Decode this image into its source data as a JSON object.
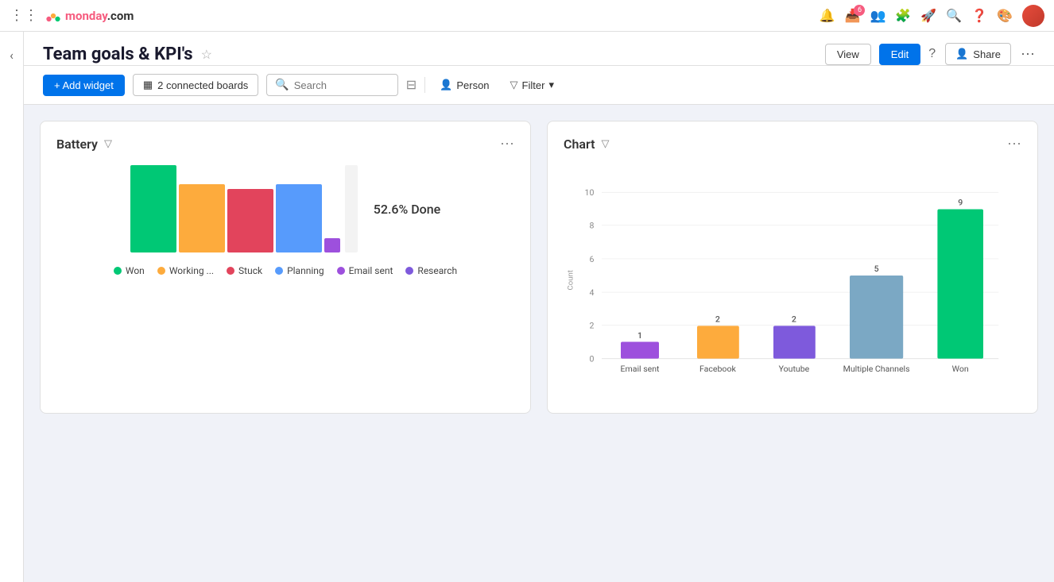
{
  "app": {
    "name": "monday",
    "domain": ".com"
  },
  "topnav": {
    "notifications_badge": "6",
    "help_tooltip": "Help"
  },
  "page": {
    "title": "Team goals & KPI's",
    "view_label": "View",
    "edit_label": "Edit",
    "share_label": "Share",
    "add_widget_label": "+ Add widget",
    "connected_boards_label": "2 connected boards",
    "search_placeholder": "Search",
    "person_label": "Person",
    "filter_label": "Filter"
  },
  "battery_widget": {
    "title": "Battery",
    "percentage_text": "52.6% Done",
    "legend": [
      {
        "label": "Won",
        "color": "#00c875"
      },
      {
        "label": "Working ...",
        "color": "#fdab3d"
      },
      {
        "label": "Stuck",
        "color": "#e2445c"
      },
      {
        "label": "Planning",
        "color": "#579bfc"
      },
      {
        "label": "Email sent",
        "color": "#9d50dd"
      },
      {
        "label": "Research",
        "color": "#7e5adc"
      }
    ],
    "bars": [
      {
        "color": "#00c875",
        "heightPct": 1.0
      },
      {
        "color": "#fdab3d",
        "heightPct": 0.78
      },
      {
        "color": "#e2445c",
        "heightPct": 0.72
      },
      {
        "color": "#579bfc",
        "heightPct": 0.78
      },
      {
        "color": "#9d50dd",
        "heightPct": 0.15
      }
    ]
  },
  "chart_widget": {
    "title": "Chart",
    "y_label": "Count",
    "bars": [
      {
        "label": "Email sent",
        "value": 1,
        "color": "#9d50dd"
      },
      {
        "label": "Facebook",
        "value": 2,
        "color": "#fdab3d"
      },
      {
        "label": "Youtube",
        "value": 2,
        "color": "#7e5adc"
      },
      {
        "label": "Multiple Channels",
        "value": 5,
        "color": "#7ba8c4"
      },
      {
        "label": "Won",
        "value": 9,
        "color": "#00c875"
      }
    ],
    "y_max": 10,
    "y_ticks": [
      0,
      2,
      4,
      6,
      8,
      10
    ]
  }
}
